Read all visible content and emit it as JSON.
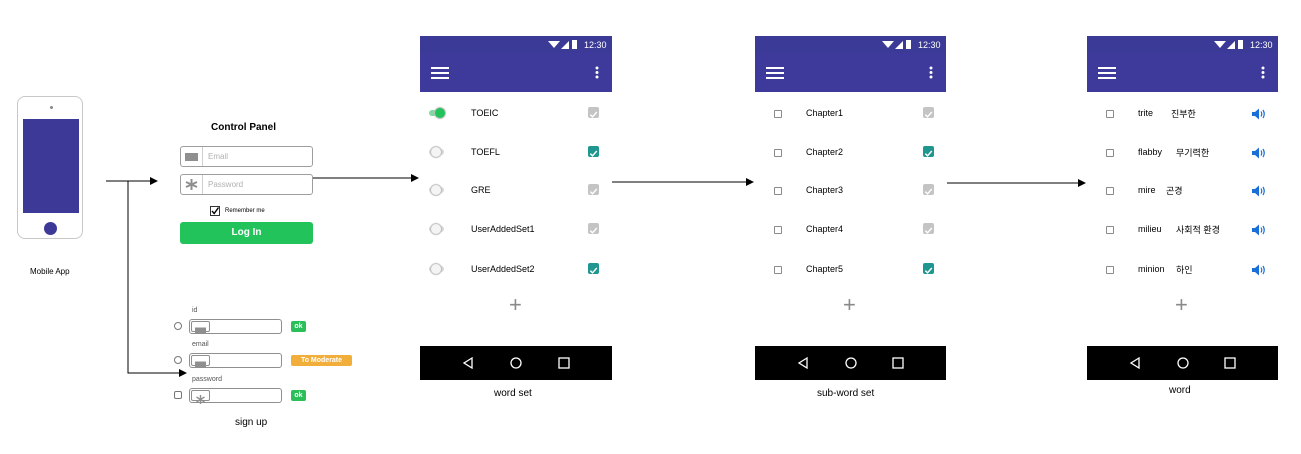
{
  "mobile_app": {
    "caption": "Mobile App"
  },
  "login": {
    "title": "Control Panel",
    "email_placeholder": "Email",
    "password_placeholder": "Password",
    "remember_me": "Remember me",
    "login_button": "Log In"
  },
  "signup": {
    "caption": "sign up",
    "fields": [
      {
        "label": "id",
        "badge": "ok",
        "badge_color": "#2bbf5a"
      },
      {
        "label": "email",
        "badge": "To Moderate",
        "badge_color": "#f2ae3a"
      },
      {
        "label": "password",
        "badge": "ok",
        "badge_color": "#2bbf5a"
      }
    ]
  },
  "status": {
    "time": "12:30"
  },
  "colors": {
    "primary": "#3d3a9b",
    "check_on": "#1f968f",
    "toggle_on": "#21c35a",
    "sound": "#1a6fd6"
  },
  "word_set": {
    "caption": "word set",
    "items": [
      {
        "label": "TOEIC",
        "toggle_on": true,
        "checked": false
      },
      {
        "label": "TOEFL",
        "toggle_on": false,
        "checked": true
      },
      {
        "label": "GRE",
        "toggle_on": false,
        "checked": false
      },
      {
        "label": "UserAddedSet1",
        "toggle_on": false,
        "checked": false
      },
      {
        "label": "UserAddedSet2",
        "toggle_on": false,
        "checked": true
      }
    ],
    "add_icon": "plus-icon"
  },
  "sub_word_set": {
    "caption": "sub-word set",
    "items": [
      {
        "label": "Chapter1",
        "checked": false
      },
      {
        "label": "Chapter2",
        "checked": true
      },
      {
        "label": "Chapter3",
        "checked": false
      },
      {
        "label": "Chapter4",
        "checked": false
      },
      {
        "label": "Chapter5",
        "checked": true
      }
    ]
  },
  "word": {
    "caption": "word",
    "items": [
      {
        "word": "trite",
        "meaning": "진부한"
      },
      {
        "word": "flabby",
        "meaning": "무기력한"
      },
      {
        "word": "mire",
        "meaning": "곤경"
      },
      {
        "word": "milieu",
        "meaning": "사회적 환경"
      },
      {
        "word": "minion",
        "meaning": "하인"
      }
    ]
  }
}
